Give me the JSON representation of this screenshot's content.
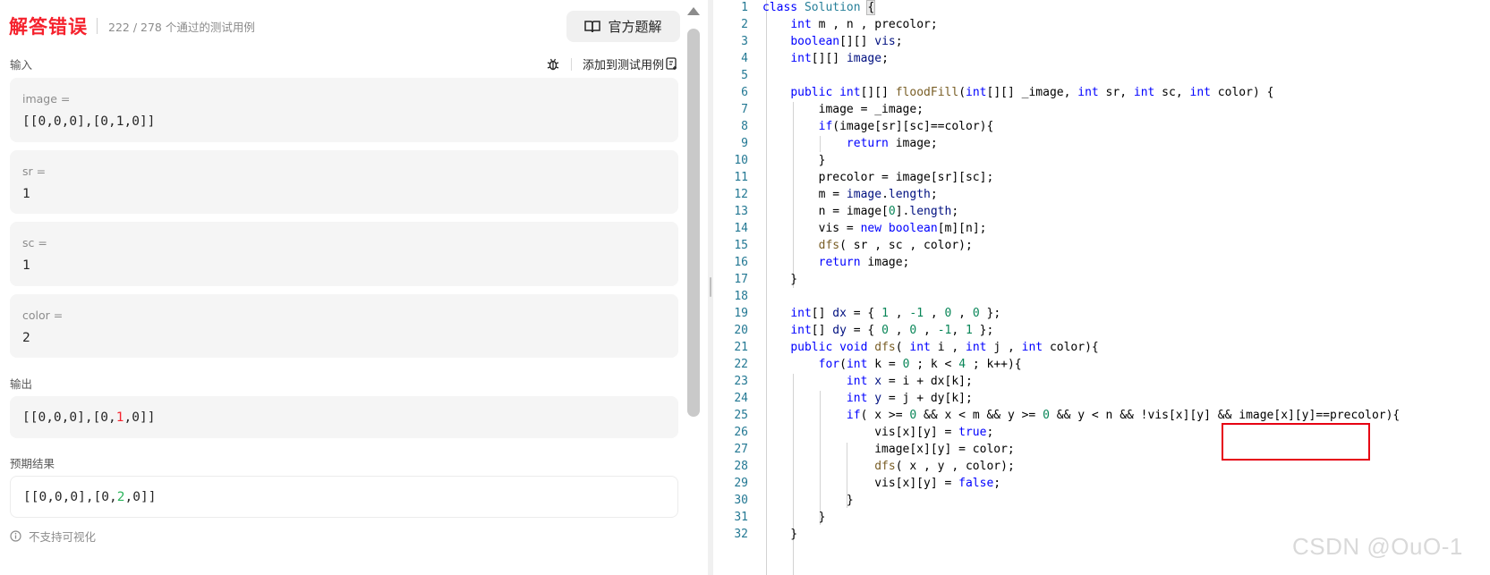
{
  "header": {
    "verdict": "解答错误",
    "passed": "222 / 278 个通过的测试用例",
    "official_solution": "官方题解"
  },
  "input": {
    "label": "输入",
    "add_testcase": "添加到测试用例",
    "vars": [
      {
        "name": "image =",
        "value": "[[0,0,0],[0,1,0]]"
      },
      {
        "name": "sr =",
        "value": "1"
      },
      {
        "name": "sc =",
        "value": "1"
      },
      {
        "name": "color =",
        "value": "2"
      }
    ]
  },
  "output": {
    "label": "输出",
    "prefix": "[[0,0,0],[0,",
    "diff": "1",
    "suffix": ",0]]"
  },
  "expected": {
    "label": "预期结果",
    "prefix": "[[0,0,0],[0,",
    "diff": "2",
    "suffix": ",0]]"
  },
  "note": "不支持可视化",
  "code": {
    "line_numbers": [
      "1",
      "2",
      "3",
      "4",
      "5",
      "6",
      "7",
      "8",
      "9",
      "10",
      "11",
      "12",
      "13",
      "14",
      "15",
      "16",
      "17",
      "18",
      "19",
      "20",
      "21",
      "22",
      "23",
      "24",
      "25",
      "26",
      "27",
      "28",
      "29",
      "30",
      "31",
      "32"
    ]
  },
  "watermark": "CSDN @OuO-1",
  "colors": {
    "verdict": "#f5222d",
    "expected_diff": "#2db55d",
    "annotation_box": "#e60012"
  },
  "icons": [
    "book-icon",
    "debug-icon",
    "add-testcase-icon",
    "info-icon",
    "scroll-up-icon"
  ]
}
